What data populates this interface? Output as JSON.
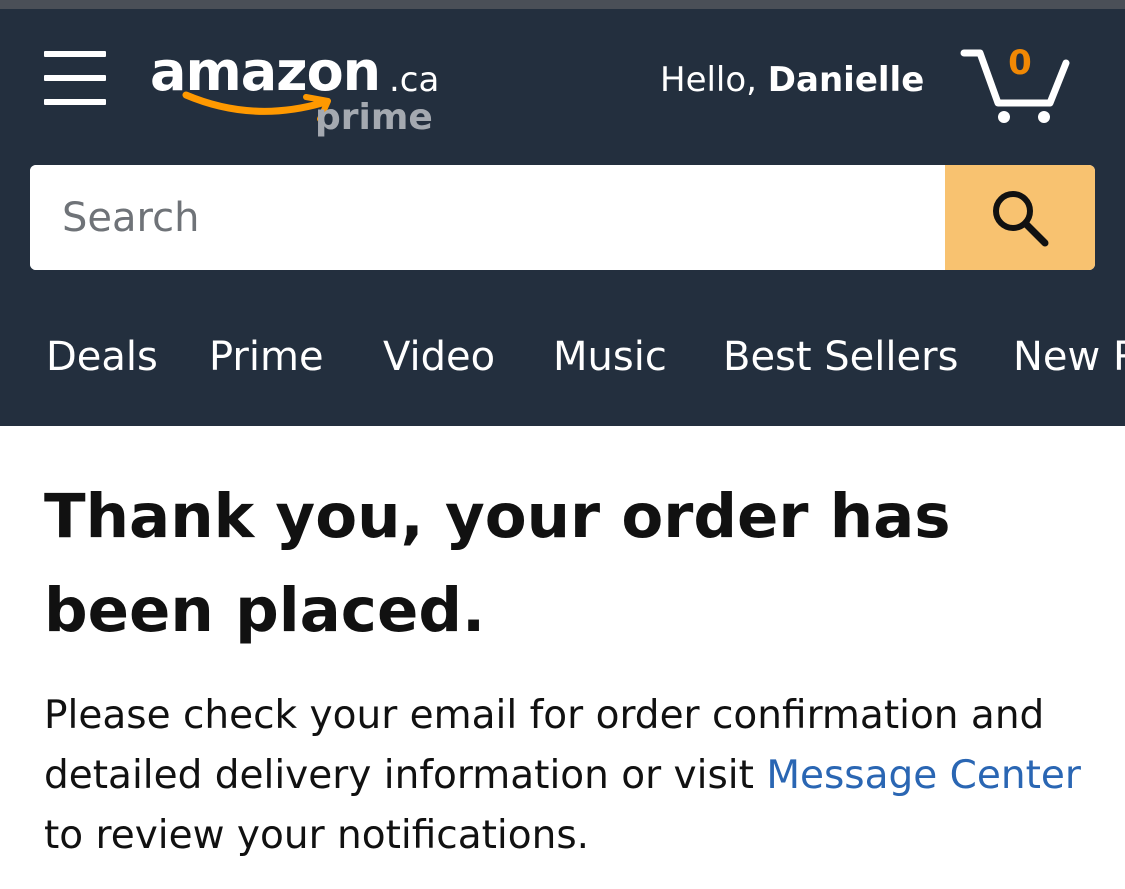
{
  "header": {
    "logo": {
      "wordmark": "amazon",
      "tld": ".ca",
      "sub": "prime"
    },
    "greeting": {
      "prefix": "Hello, ",
      "name": "Danielle"
    },
    "cart": {
      "count": "0",
      "icon": "cart-icon"
    },
    "menu_icon": "hamburger-menu-icon"
  },
  "search": {
    "placeholder": "Search",
    "value": "",
    "button_icon": "search-icon"
  },
  "nav": {
    "items": [
      "Deals",
      "Prime",
      "Video",
      "Music",
      "Best Sellers",
      "New Releases"
    ]
  },
  "main": {
    "title": "Thank you, your order has been placed.",
    "message_before": "Please check your email for order confirmation and detailed delivery information or visit ",
    "message_link": "Message Center",
    "message_after": " to review your notifications."
  },
  "colors": {
    "header_bg": "#232f3e",
    "search_button": "#f8c270",
    "link": "#2a66b3",
    "cart_count": "#f08804",
    "smile": "#f90"
  }
}
